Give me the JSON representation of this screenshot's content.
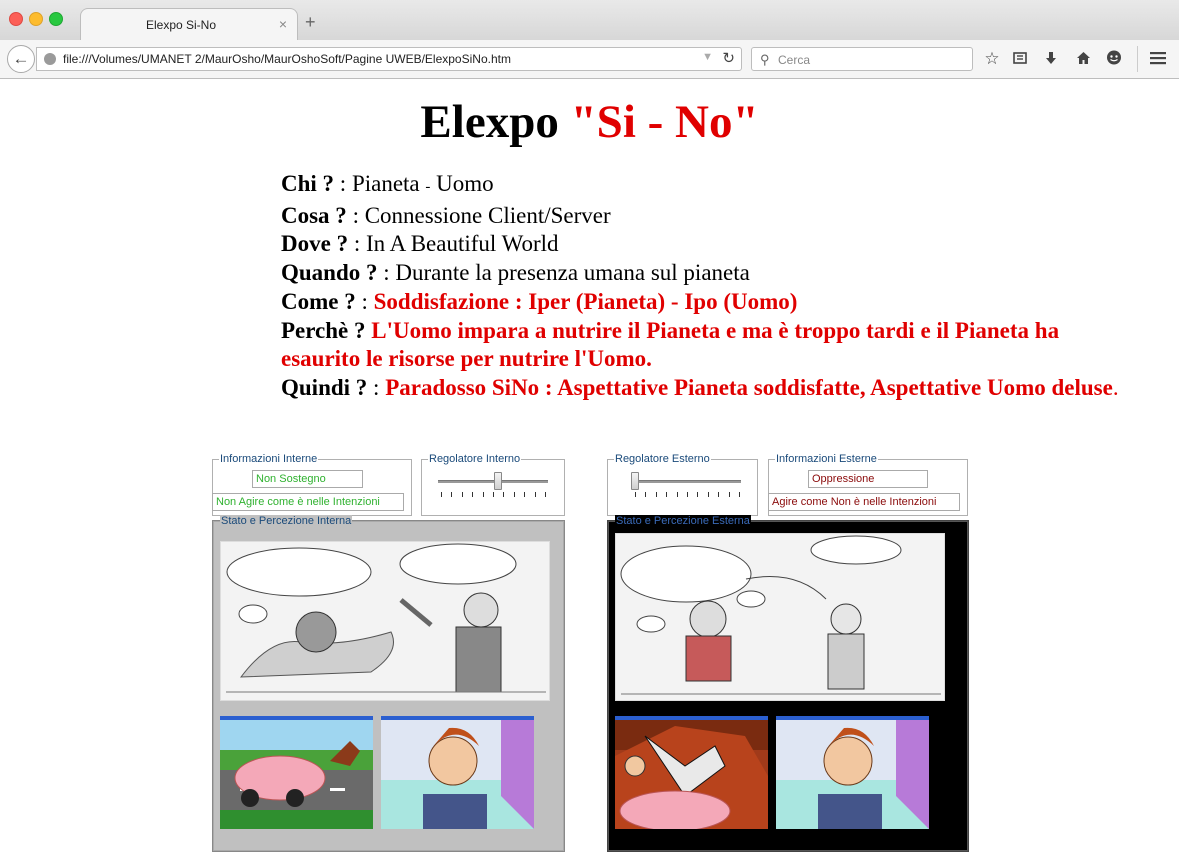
{
  "browser": {
    "tab_title": "Elexpo Si-No",
    "tab_close": "×",
    "new_tab": "+",
    "url": "file:///Volumes/UMANET 2/MaurOsho/MaurOshoSoft/Pagine UWEB/ElexpoSiNo.htm",
    "search_placeholder": "Cerca"
  },
  "page": {
    "title_main": "Elexpo",
    "title_accent": "\"Si - No\"",
    "qa": {
      "chi_q": "Chi ?",
      "chi_a1": "Pianeta",
      "chi_sep": "-",
      "chi_a2": "Uomo",
      "cosa_q": "Cosa ?",
      "cosa_a": "Connessione Client/Server",
      "dove_q": "Dove ?",
      "dove_a": "In A Beautiful World",
      "quando_q": "Quando ?",
      "quando_a": "Durante la presenza umana sul pianeta",
      "come_q": "Come ?",
      "come_a": "Soddisfazione : Iper (Pianeta) - Ipo (Uomo)",
      "perche_q": "Perchè ?",
      "perche_a": "L'Uomo impara a nutrire il Pianeta e ma è troppo tardi e il Pianeta ha esaurito le risorse per nutrire l'Uomo.",
      "quindi_q": "Quindi ?",
      "quindi_a": "Paradosso SiNo : Aspettative Pianeta soddisfatte, Aspettative Uomo deluse",
      "quindi_end": "."
    }
  },
  "left_panel": {
    "info_legend": "Informazioni Interne",
    "info_value1": "Non Sostegno",
    "info_value2": "Non Agire come è nelle Intenzioni",
    "regulator_legend": "Regolatore Interno",
    "regulator_level": 0.55,
    "state_legend": "Stato e Percezione Interna",
    "comic_caption": ""
  },
  "right_panel": {
    "regulator_legend": "Regolatore Esterno",
    "regulator_level": 0.0,
    "info_legend": "Informazioni Esterne",
    "info_value1": "Oppressione",
    "info_value2": "Agire come Non è nelle Intenzioni",
    "state_legend": "Stato e Percezione Esterna"
  },
  "colors": {
    "accent_red": "#e00000",
    "green_text": "#2fb12f",
    "panel_grey": "#c0c0c0",
    "panel_black": "#000000"
  },
  "icons": [
    "back-arrow-icon",
    "globe-icon",
    "dropdown-icon",
    "reload-icon",
    "search-icon",
    "star-icon",
    "reading-list-icon",
    "download-icon",
    "home-icon",
    "chat-icon",
    "menu-icon"
  ]
}
